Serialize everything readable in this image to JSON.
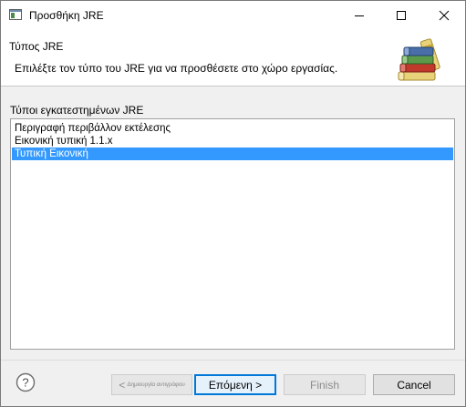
{
  "window": {
    "title": "Προσθήκη JRE",
    "controls": {
      "minimize": "minimize",
      "maximize": "maximize",
      "close": "close"
    }
  },
  "header": {
    "title": "Τύπος JRE",
    "description": "Επιλέξτε τον τύπο του JRE για να προσθέσετε στο χώρο εργασίας.",
    "icon": "books-icon"
  },
  "list": {
    "label": "Τύποι εγκατεστημένων JRE",
    "items": [
      {
        "label": "Περιγραφή περιβάλλον εκτέλεσης",
        "selected": false
      },
      {
        "label": "Εικονική τυπική 1.1.x",
        "selected": false
      },
      {
        "label": "Τυπική Εικονική",
        "selected": true
      }
    ]
  },
  "footer": {
    "help_icon": "help-icon",
    "back_prefix": "<",
    "back_label": "Δημιουργία αντιγράφου",
    "next_label": "Επόμενη >",
    "finish_label": "Finish",
    "cancel_label": "Cancel"
  },
  "colors": {
    "selection": "#3399ff",
    "primary_border": "#0078d7",
    "dialog_bg": "#f0f0f0"
  }
}
